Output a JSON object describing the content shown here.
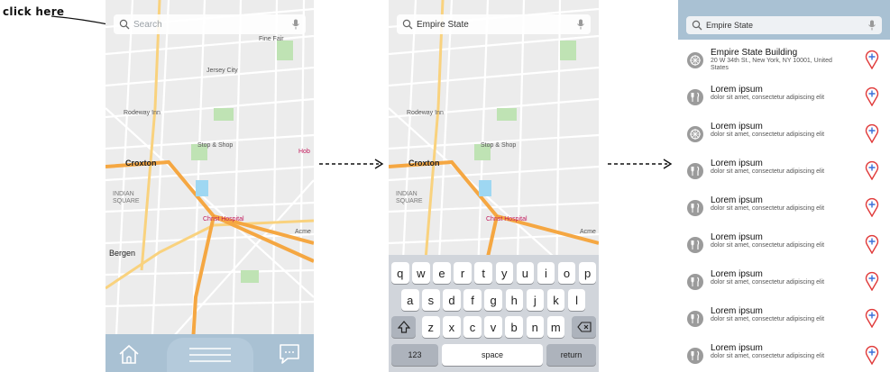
{
  "annotation": {
    "click_label": "click here"
  },
  "panel1": {
    "search_placeholder": "Search",
    "map_labels": {
      "jersey_city": "Jersey City",
      "fine_fair": "Fine Fair",
      "roadway_inn": "Rodeway Inn",
      "stop_shop": "Stop & Shop",
      "croxton": "Croxton",
      "indian_square": "INDIAN\nSQUARE",
      "christ_hospital": "Christ Hospital",
      "bergen": "Bergen",
      "hob": "Hob",
      "acme": "Acme"
    },
    "nav": {
      "home": "home",
      "menu": "menu",
      "chat": "chat"
    }
  },
  "panel2": {
    "search_value": "Empire State",
    "keyboard": {
      "row1": [
        "q",
        "w",
        "e",
        "r",
        "t",
        "y",
        "u",
        "i",
        "o",
        "p"
      ],
      "row2": [
        "a",
        "s",
        "d",
        "f",
        "g",
        "h",
        "j",
        "k",
        "l"
      ],
      "row3": [
        "z",
        "x",
        "c",
        "v",
        "b",
        "n",
        "m"
      ],
      "numbers": "123",
      "space": "space",
      "return": "return"
    }
  },
  "panel3": {
    "search_value": "Empire State",
    "results": [
      {
        "title": "Empire State Building",
        "subtitle": "20 W 34th St., New York, NY 10001, United States",
        "icon": "building-icon"
      },
      {
        "title": "Lorem ipsum",
        "subtitle": "dolor sit amet, consectetur adipiscing elit",
        "icon": "restaurant-icon"
      },
      {
        "title": "Lorem ipsum",
        "subtitle": "dolor sit amet, consectetur adipiscing elit",
        "icon": "building-icon"
      },
      {
        "title": "Lorem ipsum",
        "subtitle": "dolor sit amet, consectetur adipiscing elit",
        "icon": "restaurant-icon"
      },
      {
        "title": "Lorem ipsum",
        "subtitle": "dolor sit amet, consectetur adipiscing elit",
        "icon": "restaurant-icon"
      },
      {
        "title": "Lorem ipsum",
        "subtitle": "dolor sit amet, consectetur adipiscing elit",
        "icon": "restaurant-icon"
      },
      {
        "title": "Lorem ipsum",
        "subtitle": "dolor sit amet, consectetur adipiscing elit",
        "icon": "restaurant-icon"
      },
      {
        "title": "Lorem ipsum",
        "subtitle": "dolor sit amet, consectetur adipiscing elit",
        "icon": "restaurant-icon"
      },
      {
        "title": "Lorem ipsum",
        "subtitle": "dolor sit amet, consectetur adipiscing elit",
        "icon": "restaurant-icon"
      }
    ]
  },
  "colors": {
    "nav_bar": "#a9c1d3",
    "map_bg": "#ececec",
    "pin_red": "#e03a3a",
    "pin_blue": "#3a6fd8",
    "highway": "#f5a742"
  }
}
